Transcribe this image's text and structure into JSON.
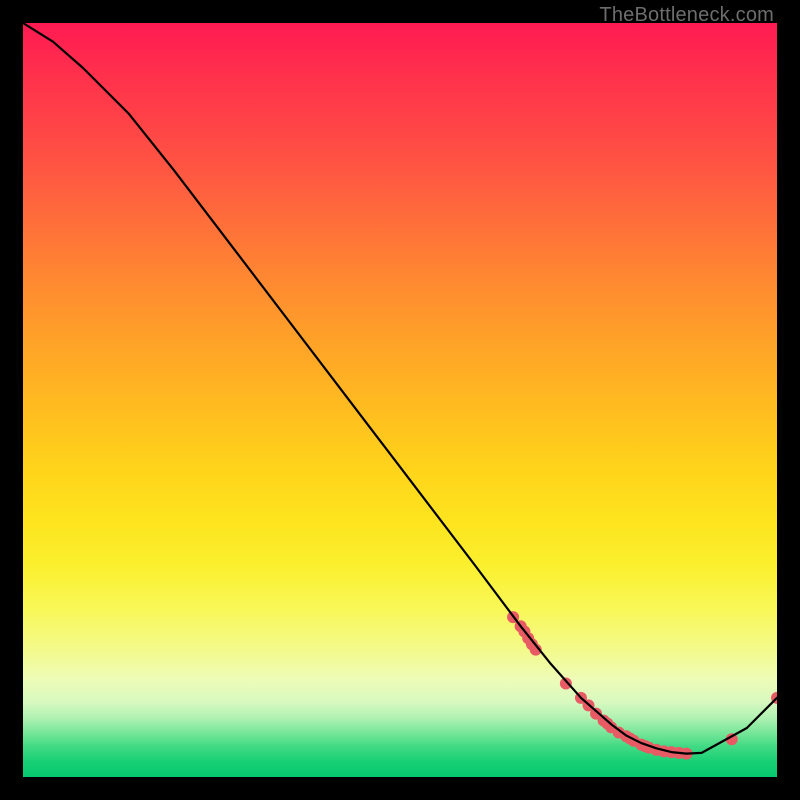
{
  "watermark": "TheBottleneck.com",
  "colors": {
    "dot": "#e85a64",
    "line": "#000000"
  },
  "chart_data": {
    "type": "line",
    "title": "",
    "xlabel": "",
    "ylabel": "",
    "xlim": [
      0,
      100
    ],
    "ylim": [
      0,
      100
    ],
    "series": [
      {
        "name": "bottleneck-curve",
        "x": [
          0,
          4,
          8,
          14,
          20,
          28,
          36,
          44,
          52,
          60,
          66,
          70,
          74,
          78,
          80,
          82,
          84,
          86,
          88,
          90,
          96,
          100
        ],
        "y": [
          100,
          97.5,
          94,
          88,
          80.5,
          70,
          59.5,
          49,
          38.5,
          28,
          20,
          15,
          10.5,
          7,
          5.5,
          4.5,
          3.8,
          3.3,
          3.1,
          3.2,
          6.5,
          10.5
        ]
      }
    ],
    "highlight_points": {
      "name": "cluster-dots",
      "x": [
        65,
        66,
        66.5,
        67,
        67.5,
        68,
        72,
        74,
        75,
        76,
        77,
        77.5,
        78,
        79,
        80,
        80.5,
        81,
        82,
        82.5,
        83,
        84,
        85,
        86,
        87,
        88,
        94,
        100
      ],
      "y": [
        21.2,
        20.0,
        19.3,
        18.4,
        17.6,
        16.9,
        12.4,
        10.5,
        9.5,
        8.4,
        7.5,
        7.1,
        6.6,
        5.9,
        5.4,
        5.1,
        4.8,
        4.3,
        4.1,
        3.9,
        3.6,
        3.4,
        3.3,
        3.2,
        3.1,
        5.0,
        10.5
      ]
    }
  }
}
